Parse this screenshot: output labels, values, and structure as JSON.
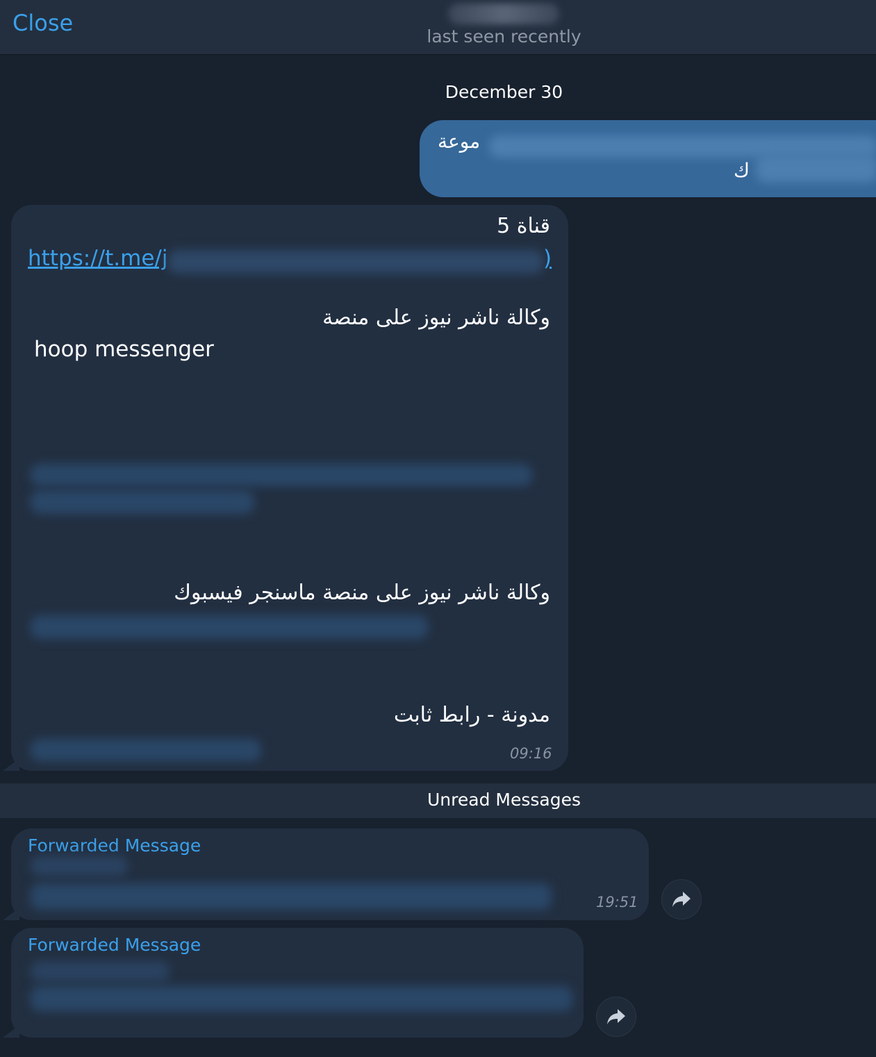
{
  "header": {
    "close_label": "Close",
    "status": "last seen recently"
  },
  "date_separator": "December 30",
  "outgoing": {
    "line1": "موعة",
    "line2": "ك"
  },
  "incoming_main": {
    "title": "قناة 5",
    "link_prefix": "https://t.me/j",
    "link_suffix": ")",
    "line_agency": "وكالة ناشر نيوز على منصة",
    "line_platform": "hoop messenger",
    "line_facebook": "وكالة ناشر نيوز  على منصة ماسنجر فيسبوك",
    "line_blog": "مدونة - رابط ثابت",
    "time": "09:16"
  },
  "unread_label": "Unread Messages",
  "forwarded": [
    {
      "title": "Forwarded Message",
      "time": "19:51"
    },
    {
      "title": "Forwarded Message"
    }
  ],
  "colors": {
    "accent": "#3ba0ea",
    "outgoing_bubble": "#36689a",
    "incoming_bubble": "#222f41",
    "background": "#18212e"
  }
}
